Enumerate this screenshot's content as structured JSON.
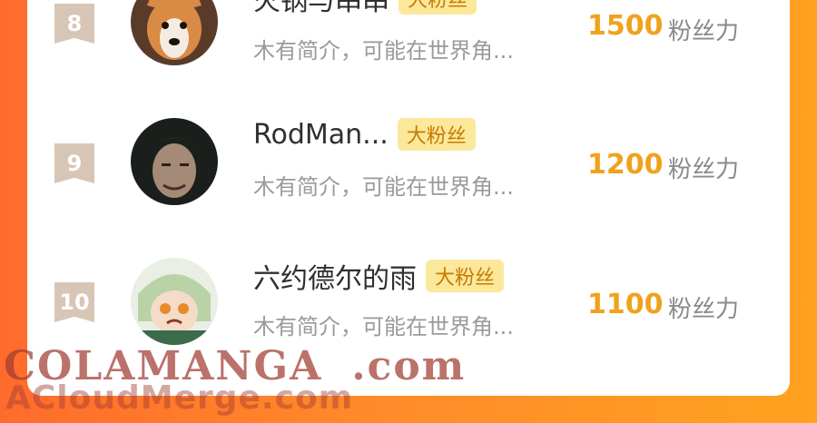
{
  "ranking": {
    "items": [
      {
        "rank": "8",
        "name": "火锅与串串",
        "badge": "大粉丝",
        "intro": "木有简介，可能在世界角...",
        "score": "1500",
        "score_unit": "粉丝力"
      },
      {
        "rank": "9",
        "name": "RodMan...",
        "badge": "大粉丝",
        "intro": "木有简介，可能在世界角...",
        "score": "1200",
        "score_unit": "粉丝力"
      },
      {
        "rank": "10",
        "name": "六约德尔的雨",
        "badge": "大粉丝",
        "intro": "木有简介，可能在世界角...",
        "score": "1100",
        "score_unit": "粉丝力"
      }
    ]
  },
  "watermark": {
    "line1_main": "COLAMANGA",
    "line1_suffix": ".com",
    "line2": "ACloudMerge.com"
  },
  "colors": {
    "background_start": "#ff6b2c",
    "background_end": "#ffa21f",
    "score": "#f0a21c",
    "badge_bg": "#fbe89a",
    "rank_badge": "#d7c6b6"
  }
}
